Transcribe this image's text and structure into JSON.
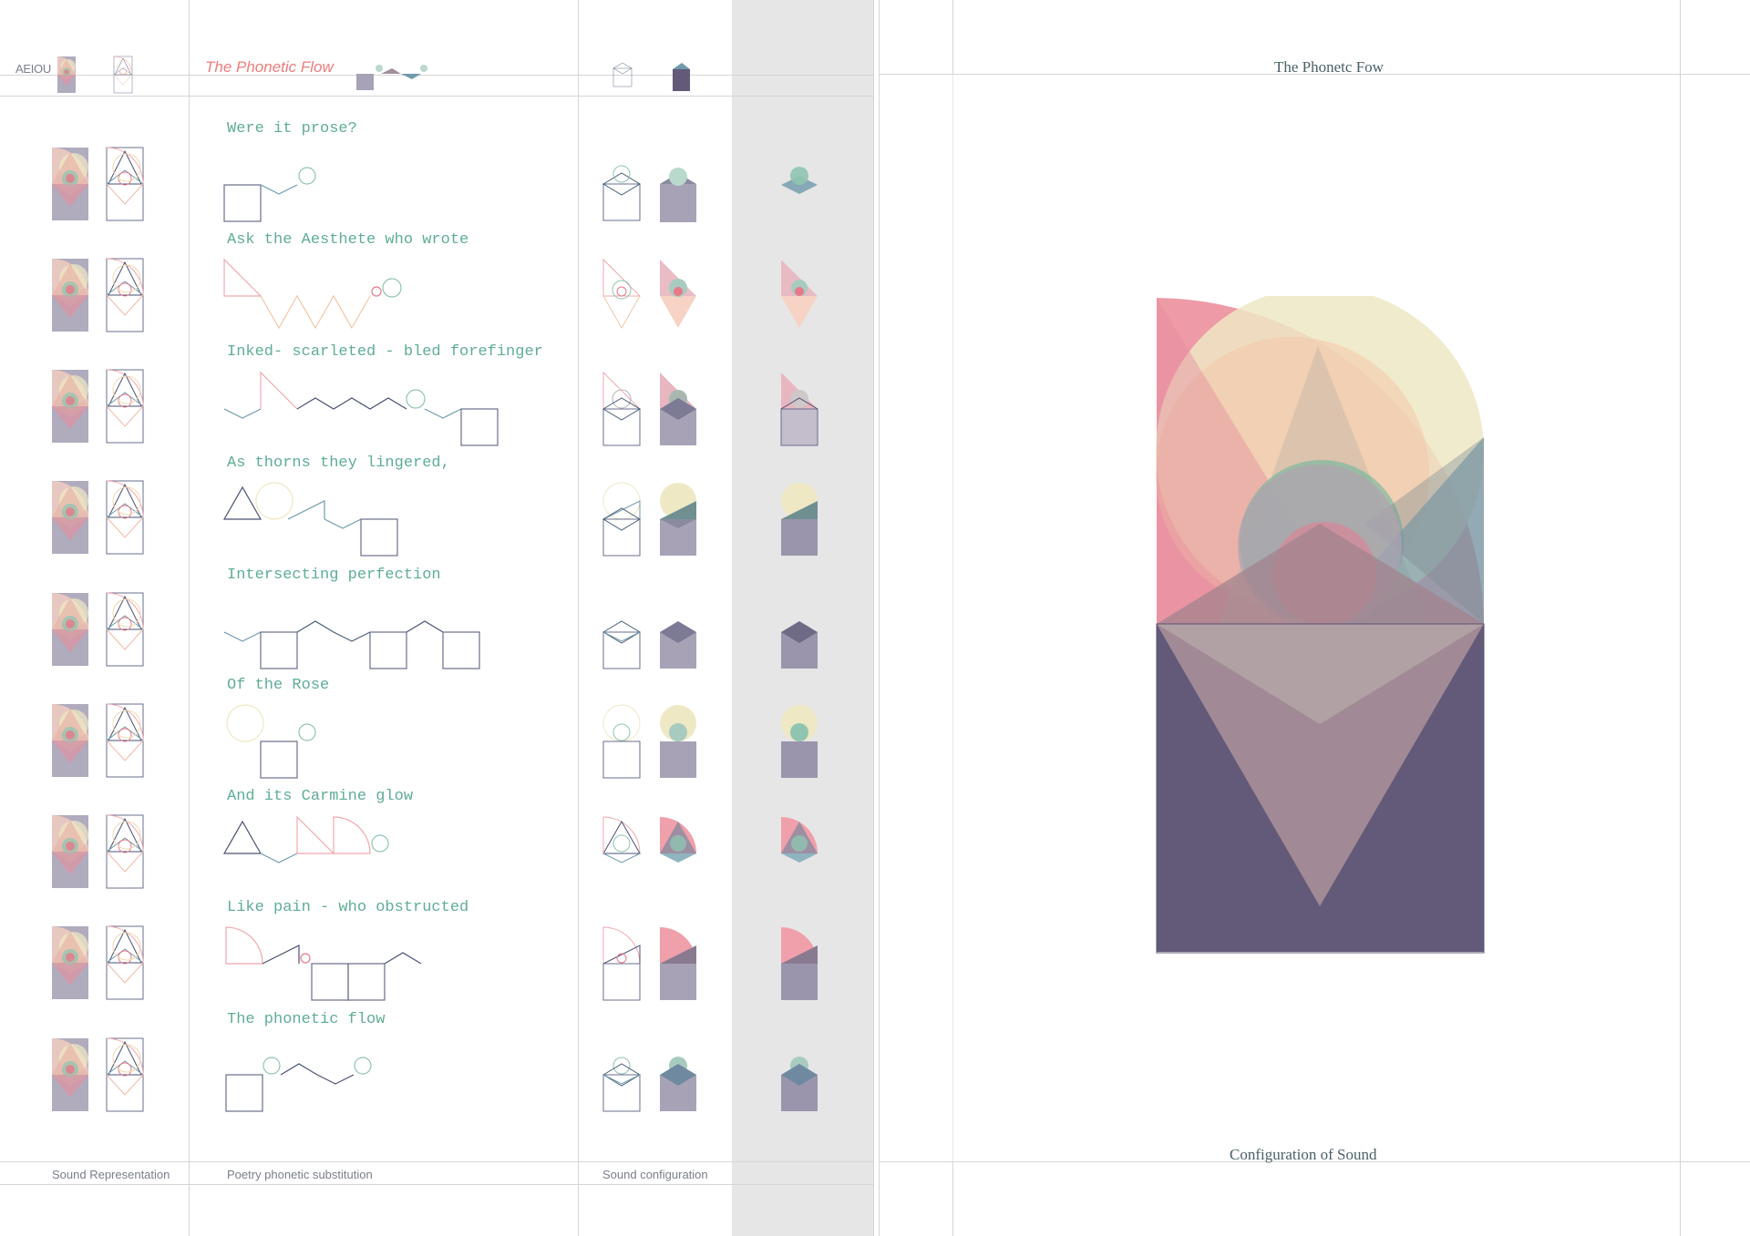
{
  "header": {
    "vowels_label": "AEIOU",
    "title": "The Phonetic Flow"
  },
  "verses": [
    "Were it prose?",
    "Ask the Aesthete who wrote",
    "Inked- scarleted - bled forefinger",
    "As thorns they lingered,",
    "Intersecting perfection",
    "Of the Rose",
    "And its Carmine glow",
    "Like pain - who obstructed",
    "The phonetic flow"
  ],
  "footer": {
    "sound_representation": "Sound Representation",
    "poetry_substitution": "Poetry phonetic substitution",
    "sound_configuration": "Sound configuration"
  },
  "right_page": {
    "title": "The Phonetc Fow",
    "caption": "Configuration of Sound"
  },
  "colors": {
    "pink": "#e8788a",
    "peach": "#f3c6a8",
    "cream": "#efe8c4",
    "teal": "#8fc4b0",
    "steel_blue": "#6f9aab",
    "navy_outline": "#4a5273",
    "plum": "#625a78",
    "mauve": "#a98e98"
  }
}
